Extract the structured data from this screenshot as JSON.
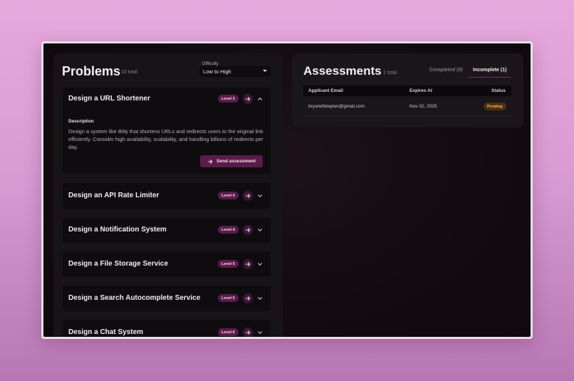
{
  "problems": {
    "title": "Problems",
    "count": "10 total",
    "difficulty_label": "Difficulty",
    "difficulty_value": "Low to High",
    "items": [
      {
        "title": "Design a URL Shortener",
        "level": "Level 3",
        "expanded": true,
        "description_heading": "Description",
        "description": "Design a system like Bitly that shortens URLs and redirects users to the original link efficiently. Consider high availability, scalability, and handling billions of redirects per day.",
        "send_label": "Send assessment"
      },
      {
        "title": "Design an API Rate Limiter",
        "level": "Level 4"
      },
      {
        "title": "Design a Notification System",
        "level": "Level 4"
      },
      {
        "title": "Design a File Storage Service",
        "level": "Level 5"
      },
      {
        "title": "Design a Search Autocomplete Service",
        "level": "Level 5"
      },
      {
        "title": "Design a Chat System",
        "level": "Level 6"
      }
    ]
  },
  "assessments": {
    "title": "Assessments",
    "count": "1 total",
    "tabs": [
      "Completed (0)",
      "Incomplete (1)"
    ],
    "columns": [
      "Applicant Email",
      "Expires At",
      "Status"
    ],
    "rows": [
      {
        "email": "bryanefetaylan@gmail.com",
        "expires": "Nov 02, 2025",
        "status": "Pending"
      }
    ]
  },
  "colors": {
    "accent": "#5a1b4b",
    "pending_bg": "#4a3114",
    "pending_text": "#e8b773"
  },
  "icons": [
    "arrow-right-icon",
    "chevron-up-icon",
    "chevron-down-icon",
    "dropdown-caret-icon"
  ]
}
